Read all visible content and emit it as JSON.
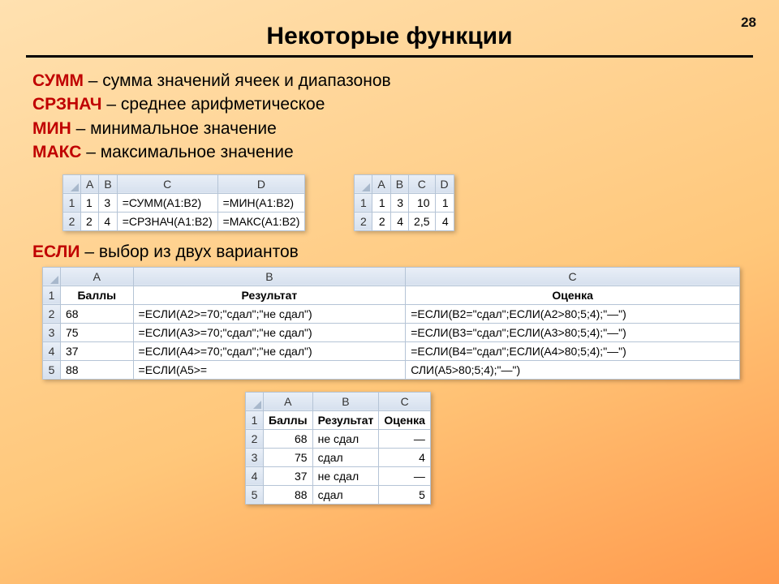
{
  "pageNumber": "28",
  "title": "Некоторые функции",
  "defs": [
    {
      "fn": "СУММ",
      "desc": " – сумма значений ячеек и диапазонов"
    },
    {
      "fn": "СРЗНАЧ",
      "desc": " – среднее арифметическое"
    },
    {
      "fn": "МИН",
      "desc": " – минимальное значение"
    },
    {
      "fn": "МАКС",
      "desc": " – максимальное значение"
    }
  ],
  "table1": {
    "cols": [
      "A",
      "B",
      "C",
      "D"
    ],
    "rows": [
      {
        "n": "1",
        "cells": [
          "1",
          "3",
          "=СУММ(A1:B2)",
          "=МИН(A1:B2)"
        ]
      },
      {
        "n": "2",
        "cells": [
          "2",
          "4",
          "=СРЗНАЧ(A1:B2)",
          "=МАКС(A1:B2)"
        ]
      }
    ]
  },
  "table2": {
    "cols": [
      "A",
      "B",
      "C",
      "D"
    ],
    "rows": [
      {
        "n": "1",
        "cells": [
          "1",
          "3",
          "10",
          "1"
        ]
      },
      {
        "n": "2",
        "cells": [
          "2",
          "4",
          "2,5",
          "4"
        ]
      }
    ]
  },
  "esli": {
    "fn": "ЕСЛИ",
    "desc": " – выбор из двух вариантов"
  },
  "table3": {
    "cols": [
      "A",
      "B",
      "C"
    ],
    "hdr": [
      "Баллы",
      "Результат",
      "Оценка"
    ],
    "rows": [
      {
        "n": "2",
        "cells": [
          "68",
          "=ЕСЛИ(A2>=70;\"сдал\";\"не сдал\")",
          "=ЕСЛИ(B2=\"сдал\";ЕСЛИ(A2>80;5;4);\"—\")"
        ]
      },
      {
        "n": "3",
        "cells": [
          "75",
          "=ЕСЛИ(A3>=70;\"сдал\";\"не сдал\")",
          "=ЕСЛИ(B3=\"сдал\";ЕСЛИ(A3>80;5;4);\"—\")"
        ]
      },
      {
        "n": "4",
        "cells": [
          "37",
          "=ЕСЛИ(A4>=70;\"сдал\";\"не сдал\")",
          "=ЕСЛИ(B4=\"сдал\";ЕСЛИ(A4>80;5;4);\"—\")"
        ]
      },
      {
        "n": "5",
        "cells": [
          "88",
          "=ЕСЛИ(A5>=",
          "СЛИ(A5>80;5;4);\"—\")"
        ]
      }
    ]
  },
  "table4": {
    "cols": [
      "A",
      "B",
      "C"
    ],
    "hdr": [
      "Баллы",
      "Результат",
      "Оценка"
    ],
    "rows": [
      {
        "n": "2",
        "cells": [
          "68",
          "не сдал",
          "—"
        ]
      },
      {
        "n": "3",
        "cells": [
          "75",
          "сдал",
          "4"
        ]
      },
      {
        "n": "4",
        "cells": [
          "37",
          "не сдал",
          "—"
        ]
      },
      {
        "n": "5",
        "cells": [
          "88",
          "сдал",
          "5"
        ]
      }
    ]
  }
}
